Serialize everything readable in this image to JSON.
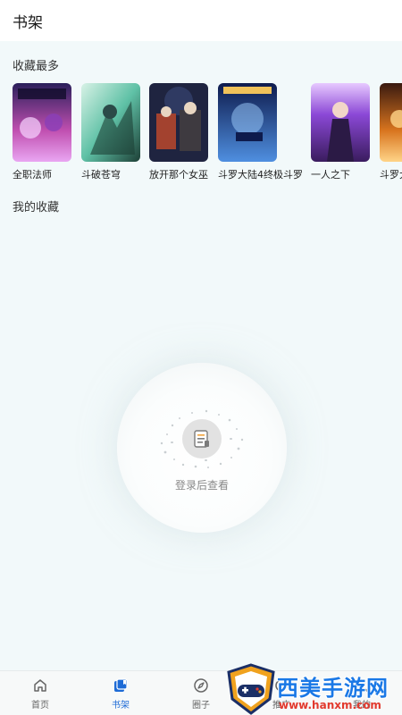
{
  "header": {
    "title": "书架"
  },
  "sections": {
    "most_favorited": "收藏最多",
    "my_favorites": "我的收藏"
  },
  "books": [
    {
      "title": "全职法师",
      "colors": [
        "#2a1f5a",
        "#c04fb0",
        "#e9a6f2"
      ]
    },
    {
      "title": "斗破苍穹",
      "colors": [
        "#1d3f36",
        "#5fc1a6",
        "#d8f2e6"
      ]
    },
    {
      "title": "放开那个女巫",
      "colors": [
        "#2c2430",
        "#a3422f",
        "#e8d6c2"
      ]
    },
    {
      "title": "斗罗大陆4终极斗罗",
      "colors": [
        "#0e1b4d",
        "#4f8fe0",
        "#f0c25a"
      ]
    },
    {
      "title": "一人之下",
      "colors": [
        "#3a1c5e",
        "#8b48d6",
        "#e7c9ff"
      ]
    },
    {
      "title": "斗罗大",
      "colors": [
        "#3a1a10",
        "#d8741e",
        "#ffd488"
      ]
    }
  ],
  "empty_state": {
    "text": "登录后查看",
    "icon": "document-list-icon"
  },
  "tabs": [
    {
      "label": "首页",
      "icon": "home-icon",
      "active": false
    },
    {
      "label": "书架",
      "icon": "bookshelf-icon",
      "active": true
    },
    {
      "label": "圈子",
      "icon": "compass-icon",
      "active": false
    },
    {
      "label": "推广",
      "icon": "share-icon",
      "active": false
    },
    {
      "label": "我的",
      "icon": "user-icon",
      "active": false
    }
  ],
  "watermark": {
    "name": "西美手游网",
    "url": "www.hanxm.com"
  },
  "colors": {
    "accent": "#1e6bd6",
    "background": "#f2f9fa"
  }
}
